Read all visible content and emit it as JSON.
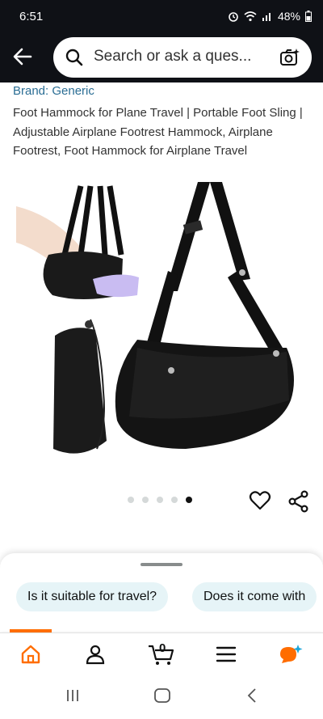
{
  "status": {
    "time": "6:51",
    "battery": "48%"
  },
  "search": {
    "placeholder": "Search or ask a ques..."
  },
  "product": {
    "brand": "Brand: Generic",
    "title": "Foot Hammock for Plane Travel | Portable Foot Sling | Adjustable Airplane Footrest Hammock, Airplane Footrest, Foot Hammock for Airplane Travel",
    "image_count": 5,
    "active_image_index": 5
  },
  "suggestions": [
    "Is it suitable for travel?",
    "Does it come with"
  ],
  "bottom_nav": {
    "items": [
      "home-icon",
      "account-icon",
      "cart-icon",
      "menu-icon",
      "rufus-icon"
    ],
    "cart_count": "0"
  },
  "colors": {
    "accent": "#ff6d00",
    "link": "#2a6d94",
    "chip": "#e6f4f7",
    "header": "#0f1116"
  }
}
